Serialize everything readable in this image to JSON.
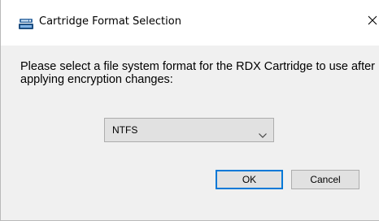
{
  "window": {
    "title": "Cartridge Format Selection",
    "icon": "rdx-drive-icon",
    "close_glyph": "✕"
  },
  "message": "Please select a file system format for the RDX Cartridge to use after applying encryption changes:",
  "format_select": {
    "selected": "NTFS",
    "icon": "chevron-down-icon"
  },
  "buttons": {
    "ok_label": "OK",
    "cancel_label": "Cancel"
  },
  "colors": {
    "default_button_border": "#0078d7",
    "button_face": "#e1e1e1",
    "dialog_background": "#f0f0f0"
  }
}
